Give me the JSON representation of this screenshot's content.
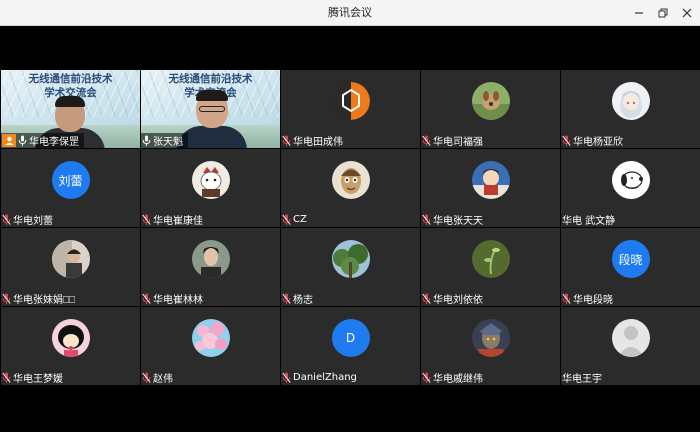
{
  "window": {
    "title": "腾讯会议"
  },
  "grid": {
    "tiles": [
      {
        "name": "华电李保罡",
        "type": "video",
        "banner": [
          "无线通信前沿技术",
          "学术交流会"
        ],
        "host": true,
        "muted": false,
        "person": "a"
      },
      {
        "name": "张天魁",
        "type": "video",
        "banner": [
          "无线通信前沿技术",
          "学术交流会"
        ],
        "host": false,
        "muted": false,
        "person": "b"
      },
      {
        "name": "华电田成伟",
        "type": "avatar",
        "icon": "orange-hexagon-avatar-icon",
        "muted": true
      },
      {
        "name": "华电司福强",
        "type": "avatar",
        "icon": "dog-photo-avatar-icon",
        "muted": true
      },
      {
        "name": "华电杨亚欣",
        "type": "avatar",
        "icon": "anime-girl-avatar-icon",
        "muted": true
      },
      {
        "name": "华电刘蕾",
        "type": "avatar",
        "avatar_text": "刘蕾",
        "muted": true
      },
      {
        "name": "华电崔康佳",
        "type": "avatar",
        "icon": "cartoon-cat-avatar-icon",
        "muted": true
      },
      {
        "name": "CZ",
        "type": "avatar",
        "icon": "cartoon-face-avatar-icon",
        "muted": true
      },
      {
        "name": "华电张天天",
        "type": "avatar",
        "icon": "cartoon-doll-avatar-icon",
        "muted": true
      },
      {
        "name": "华电 武文静",
        "type": "avatar",
        "icon": "snoopy-avatar-icon",
        "muted": false
      },
      {
        "name": "华电张妹娟⎕⎕",
        "type": "avatar",
        "icon": "person-photo-avatar-icon",
        "muted": true
      },
      {
        "name": "华电崔林林",
        "type": "avatar",
        "icon": "man-portrait-avatar-icon",
        "muted": true
      },
      {
        "name": "杨志",
        "type": "avatar",
        "icon": "forest-avatar-icon",
        "muted": true
      },
      {
        "name": "华电刘依依",
        "type": "avatar",
        "icon": "green-plant-avatar-icon",
        "muted": true
      },
      {
        "name": "华电段晓",
        "type": "avatar",
        "avatar_text": "段晓",
        "muted": true
      },
      {
        "name": "华电王梦媛",
        "type": "avatar",
        "icon": "cartoon-girl-avatar-icon",
        "muted": true
      },
      {
        "name": "赵伟",
        "type": "avatar",
        "icon": "pink-blossom-avatar-icon",
        "muted": true
      },
      {
        "name": "DanielZhang",
        "type": "avatar",
        "avatar_text": "D",
        "muted": true
      },
      {
        "name": "华电戚继伟",
        "type": "avatar",
        "icon": "game-character-avatar-icon",
        "muted": true
      },
      {
        "name": "华电王宇",
        "type": "avatar",
        "icon": "default-user-avatar-icon",
        "muted": false
      }
    ]
  },
  "colors": {
    "avatar_blue": "#1e7cf0",
    "host_badge": "#f08a1b",
    "mic_muted": "#e0424a",
    "tile_bg": "#2b2b2b"
  }
}
